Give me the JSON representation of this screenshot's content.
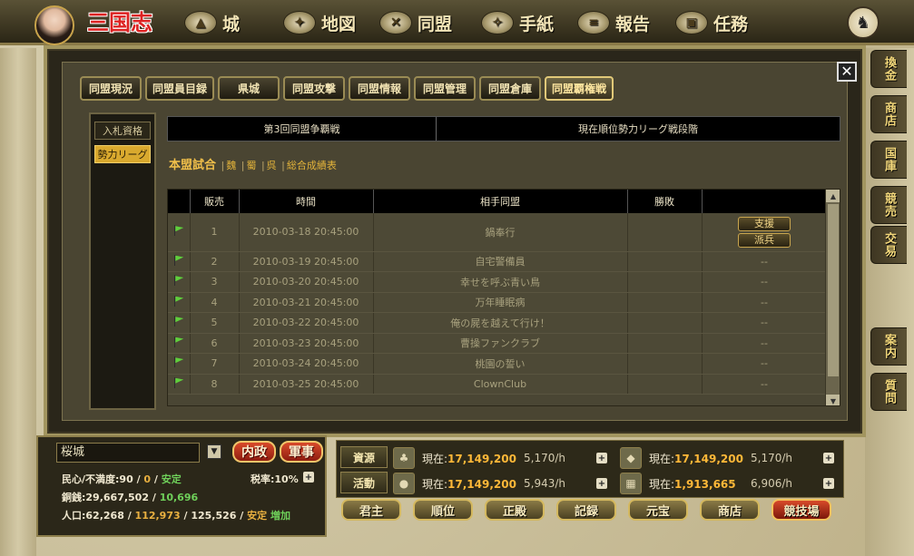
{
  "top_nav": {
    "logo": "三国志",
    "items": [
      {
        "label": "城",
        "icon": "castle-icon"
      },
      {
        "label": "地図",
        "icon": "map-icon"
      },
      {
        "label": "同盟",
        "icon": "alliance-icon"
      },
      {
        "label": "手紙",
        "icon": "bird-icon"
      },
      {
        "label": "報告",
        "icon": "scroll-icon"
      },
      {
        "label": "任務",
        "icon": "quest-icon"
      }
    ]
  },
  "side_tabs": [
    "換金",
    "商店",
    "国庫",
    "競売",
    "交易",
    "案内",
    "質問"
  ],
  "window": {
    "close_label": "✕",
    "tabs": [
      "同盟現況",
      "同盟員目録",
      "県城",
      "同盟攻撃",
      "同盟情報",
      "同盟管理",
      "同盟倉庫",
      "同盟覇権戦"
    ],
    "active_tab": 7,
    "subnav": [
      "入札資格",
      "勢力リーグ"
    ],
    "active_sub": 1,
    "info_round": "第3回同盟争覇戦",
    "info_phase": "現在順位勢力リーグ戦段階",
    "match_links": {
      "title": "本盟試合",
      "links": [
        "魏",
        "蜀",
        "呉",
        "総合成績表"
      ]
    },
    "table": {
      "headers": [
        "",
        "販売",
        "時間",
        "相手同盟",
        "勝敗",
        ""
      ],
      "rows": [
        {
          "no": "1",
          "time": "2010-03-18 20:45:00",
          "opponent": "鍋奉行",
          "result": "",
          "actions": [
            "支援",
            "派兵"
          ]
        },
        {
          "no": "2",
          "time": "2010-03-19 20:45:00",
          "opponent": "自宅警備員",
          "result": "",
          "actions": [],
          "status": "--"
        },
        {
          "no": "3",
          "time": "2010-03-20 20:45:00",
          "opponent": "幸せを呼ぶ青い鳥",
          "result": "",
          "actions": [],
          "status": "--"
        },
        {
          "no": "4",
          "time": "2010-03-21 20:45:00",
          "opponent": "万年睡眠病",
          "result": "",
          "actions": [],
          "status": "--"
        },
        {
          "no": "5",
          "time": "2010-03-22 20:45:00",
          "opponent": "俺の屍を越えて行け！",
          "result": "",
          "actions": [],
          "status": "--"
        },
        {
          "no": "6",
          "time": "2010-03-23 20:45:00",
          "opponent": "曹操ファンクラブ",
          "result": "",
          "actions": [],
          "status": "--"
        },
        {
          "no": "7",
          "time": "2010-03-24 20:45:00",
          "opponent": "桃園の誓い",
          "result": "",
          "actions": [],
          "status": "--"
        },
        {
          "no": "8",
          "time": "2010-03-25 20:45:00",
          "opponent": "ClownClub",
          "result": "",
          "actions": [],
          "status": "--"
        }
      ]
    }
  },
  "city": {
    "name": "桜城",
    "btn_internal": "内政",
    "btn_military": "軍事",
    "morale_label": "民心/不満度:",
    "morale_value": "90",
    "morale_sep1": " / ",
    "discontent_value": "0",
    "morale_sep2": " / ",
    "morale_state": "安定",
    "tax_label": "税率:",
    "tax_value": "10%",
    "money_label": "銅銭:",
    "money_value": "29,667,502",
    "money_sep": " / ",
    "money_income": "10,696",
    "pop_label": "人口:",
    "pop_value": "62,268",
    "pop_sep1": " / ",
    "pop_cap": "112,973",
    "pop_sep2": " / ",
    "pop_max": "125,526",
    "pop_sep3": " / ",
    "pop_state": "安定",
    "pop_trend": "増加"
  },
  "resources": {
    "label_res": "資源",
    "label_act": "活動",
    "items": [
      {
        "icon": "tree-icon",
        "value_prefix": "現在:",
        "value": "17,149,200",
        "rate": "5,170/h"
      },
      {
        "icon": "ore-icon",
        "value_prefix": "現在:",
        "value": "17,149,200",
        "rate": "5,170/h"
      },
      {
        "icon": "stone-icon",
        "value_prefix": "現在:",
        "value": "17,149,200",
        "rate": "5,943/h"
      },
      {
        "icon": "grain-icon",
        "value_prefix": "現在:",
        "value": "1,913,665",
        "rate": "6,906/h"
      }
    ]
  },
  "bottom_nav": [
    "君主",
    "順位",
    "正殿",
    "記録",
    "元宝",
    "商店",
    "競技場"
  ]
}
